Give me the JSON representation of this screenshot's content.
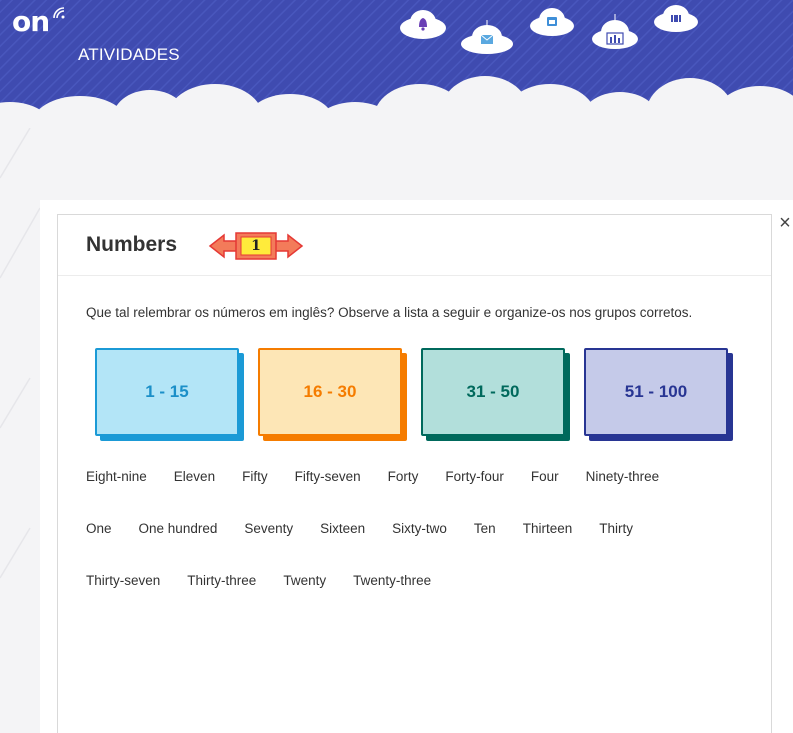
{
  "header": {
    "logo": "on",
    "title": "ATIVIDADES",
    "bg_color": "#3f4bb0",
    "nav_icons": [
      "bell-icon",
      "mail-icon",
      "calendar-icon",
      "chart-icon",
      "video-icon"
    ]
  },
  "modal": {
    "title": "Numbers",
    "step_number": "1",
    "close_label": "×",
    "instruction": "Que tal relembrar os números em inglês? Observe a lista a seguir e organize-os nos grupos corretos.",
    "groups": [
      {
        "label": "1 - 15",
        "fill": "#b3e5f7",
        "border": "#1b9ad6",
        "text": "#1b8fc8"
      },
      {
        "label": "16 - 30",
        "fill": "#fde6b6",
        "border": "#f57c00",
        "text": "#f57c00"
      },
      {
        "label": "31 - 50",
        "fill": "#b2dfdb",
        "border": "#00695c",
        "text": "#00695c"
      },
      {
        "label": "51 - 100",
        "fill": "#c5cae9",
        "border": "#283593",
        "text": "#283593"
      }
    ],
    "word_rows": [
      [
        "Eight-nine",
        "Eleven",
        "Fifty",
        "Fifty-seven",
        "Forty",
        "Forty-four",
        "Four",
        "Ninety-three"
      ],
      [
        "One",
        "One hundred",
        "Seventy",
        "Sixteen",
        "Sixty-two",
        "Ten",
        "Thirteen",
        "Thirty"
      ],
      [
        "Thirty-seven",
        "Thirty-three",
        "Twenty",
        "Twenty-three"
      ]
    ]
  }
}
